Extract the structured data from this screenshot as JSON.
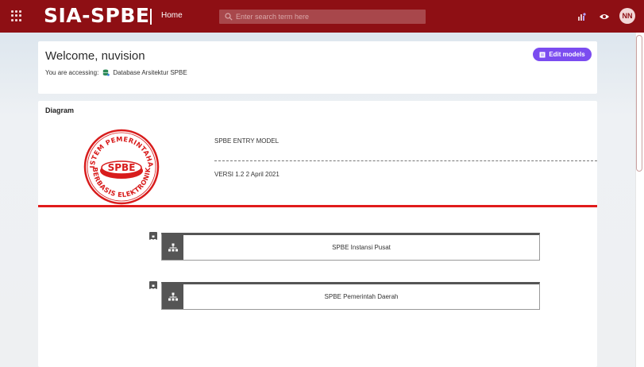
{
  "topbar": {
    "brand": "SIA-SPBE",
    "home_label": "Home",
    "search_placeholder": "Enter search term here",
    "avatar_initials": "NN"
  },
  "welcome": {
    "title": "Welcome, nuvision",
    "accessing_label": "You are accessing:",
    "database_name": "Database Arsitektur SPBE",
    "edit_button_label": "Edit models"
  },
  "diagram": {
    "title": "Diagram",
    "logo_text_top": "SISTEM PEMERINTAHAN",
    "logo_text_center": "SPBE",
    "logo_text_bottom": "BERBASIS ELEKTRONIK",
    "entry_model": "SPBE ENTRY MODEL",
    "version": "VERSI 1.2 2 April 2021",
    "submodels": [
      {
        "label": "SPBE Instansi Pusat"
      },
      {
        "label": "SPBE Pemerintah Daerah"
      }
    ]
  },
  "colors": {
    "topbar": "#8e0f14",
    "accent_button": "#7b4cf0",
    "divider_red": "#e11b1b"
  },
  "icons": [
    "apps-grid-icon",
    "search-icon",
    "analytics-icon",
    "eye-icon",
    "database-icon",
    "edit-icon",
    "hierarchy-icon"
  ]
}
